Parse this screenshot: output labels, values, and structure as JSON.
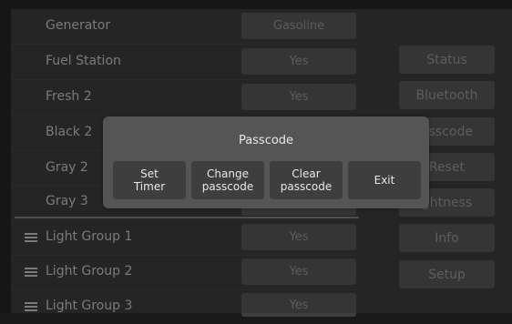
{
  "rows": [
    {
      "label": "Generator",
      "value": "Gasoline"
    },
    {
      "label": "Fuel Station",
      "value": "Yes"
    },
    {
      "label": "Fresh 2",
      "value": "Yes"
    },
    {
      "label": "Black 2",
      "value": ""
    },
    {
      "label": "Gray 2",
      "value": ""
    },
    {
      "label": "Gray 3",
      "value": ""
    }
  ],
  "groups": [
    {
      "label": "Light Group 1",
      "value": "Yes"
    },
    {
      "label": "Light Group 2",
      "value": "Yes"
    },
    {
      "label": "Light Group 3",
      "value": "Yes"
    }
  ],
  "side_buttons": [
    "Status",
    "Bluetooth",
    "asscode",
    "Reset",
    "ghtness",
    "Info",
    "Setup"
  ],
  "dialog": {
    "title": "Passcode",
    "set_timer": "Set\nTimer",
    "change_passcode": "Change\npasscode",
    "clear_passcode": "Clear\npasscode",
    "exit": "Exit"
  },
  "icons": {
    "row_handle": "menu-lines-icon"
  }
}
